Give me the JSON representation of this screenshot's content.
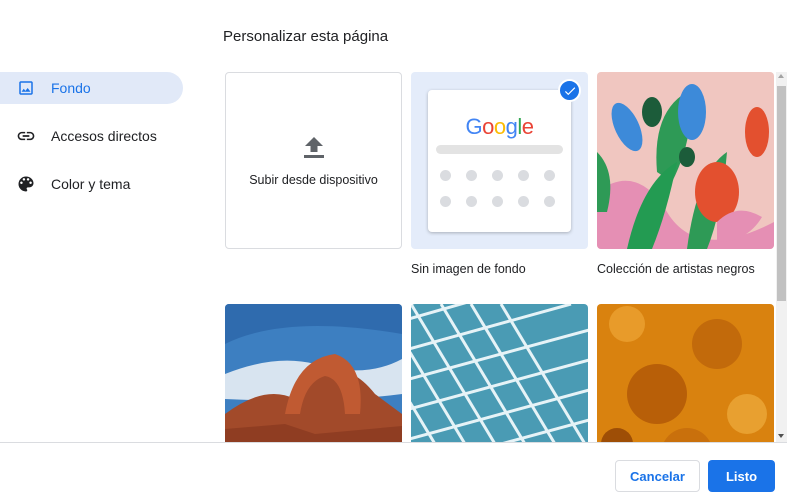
{
  "page": {
    "title": "Personalizar esta página"
  },
  "nav": {
    "items": [
      {
        "label": "Fondo",
        "icon": "image-icon",
        "active": true
      },
      {
        "label": "Accesos directos",
        "icon": "link-icon",
        "active": false
      },
      {
        "label": "Color y tema",
        "icon": "palette-icon",
        "active": false
      }
    ]
  },
  "backgrounds": {
    "upload_label": "Subir desde dispositivo",
    "no_image_label": "Sin imagen de fondo",
    "no_image_selected": true,
    "no_image_logo": "Google",
    "collection_label": "Colección de artistas negros",
    "thumbnails": [
      "arch-landscape",
      "glass-facade",
      "orange-texture"
    ]
  },
  "footer": {
    "cancel_label": "Cancelar",
    "done_label": "Listo"
  },
  "colors": {
    "accent": "#1a73e8",
    "active_nav_bg": "#e1e9f8",
    "selected_tile_bg": "#e4ecfa"
  }
}
